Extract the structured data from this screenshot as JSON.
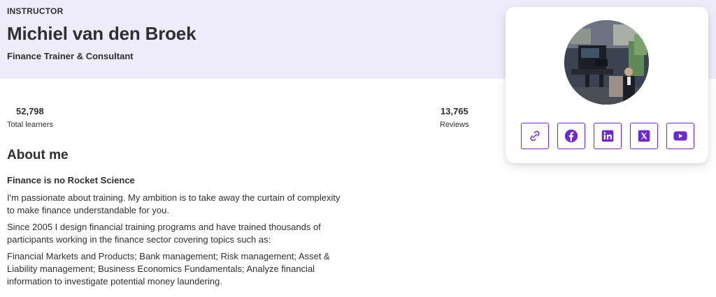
{
  "header": {
    "eyebrow": "INSTRUCTOR",
    "name": "Michiel van den Broek",
    "headline": "Finance Trainer & Consultant"
  },
  "stats": {
    "learners": {
      "value": "52,798",
      "label": "Total learners"
    },
    "reviews": {
      "value": "13,765",
      "label": "Reviews"
    }
  },
  "about": {
    "heading": "About me",
    "subheading": "Finance is no Rocket Science",
    "paragraphs": [
      "I'm passionate about training. My ambition is to take away the curtain of complexity to make finance understandable for you.",
      "Since 2005 I design financial training programs and have trained thousands of participants working in the finance sector covering topics such as:",
      "Financial Markets and Products; Bank management; Risk management; Asset & Liability management; Business Economics Fundamentals; Analyze financial information to investigate potential money laundering."
    ]
  },
  "profile_card": {
    "social_links": [
      {
        "icon": "link-icon"
      },
      {
        "icon": "facebook-icon"
      },
      {
        "icon": "linkedin-icon"
      },
      {
        "icon": "x-twitter-icon"
      },
      {
        "icon": "youtube-icon"
      }
    ]
  },
  "colors": {
    "hero_background": "#eeebfb",
    "accent": "#6d28d2",
    "text": "#2d2f31"
  }
}
